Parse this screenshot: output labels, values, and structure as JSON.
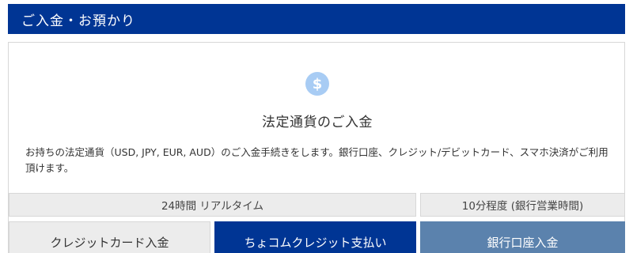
{
  "header": {
    "title": "ご入金・お預かり",
    "background_color": "#003594"
  },
  "panel": {
    "icon": "dollar-icon",
    "icon_glyph": "$",
    "title": "法定通貨のご入金",
    "description": "お持ちの法定通貨（USD, JPY, EUR, AUD）のご入金手続きをします。銀行口座、クレジット/デビットカード、スマホ決済がご利用頂けます。"
  },
  "info": {
    "left_label": "24時間 リアルタイム",
    "right_label": "10分程度 (銀行営業時間)"
  },
  "actions": {
    "credit_card_label": "クレジットカード入金",
    "chocom_label": "ちょコムクレジット支払い",
    "bank_label": "銀行口座入金",
    "chocom_color": "#003594",
    "bank_color": "#5b82ad"
  }
}
